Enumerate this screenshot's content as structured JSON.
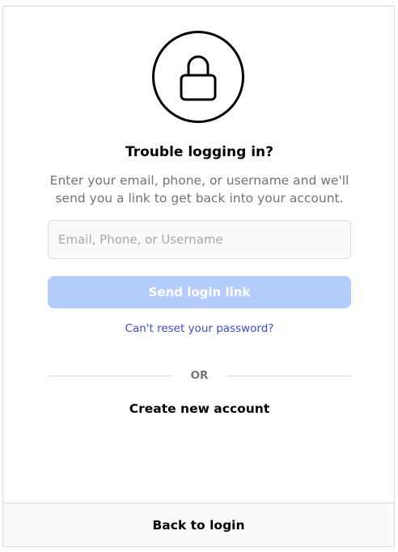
{
  "header": {
    "icon": "lock-icon",
    "title": "Trouble logging in?",
    "description_line1": "Enter your email, phone, or username and we'll",
    "description_line2": "send you a link to get back into your account."
  },
  "form": {
    "input_placeholder": "Email, Phone, or Username",
    "input_value": "",
    "send_button_label": "Send login link",
    "reset_link_label": "Can't reset your password?"
  },
  "divider": {
    "label": "OR"
  },
  "create_account_label": "Create new account",
  "footer": {
    "back_to_login_label": "Back to login"
  },
  "colors": {
    "primary_disabled": "#b5cdfd",
    "link": "#3c4bd0",
    "border": "#dbdbdb",
    "muted_text": "#737373"
  }
}
